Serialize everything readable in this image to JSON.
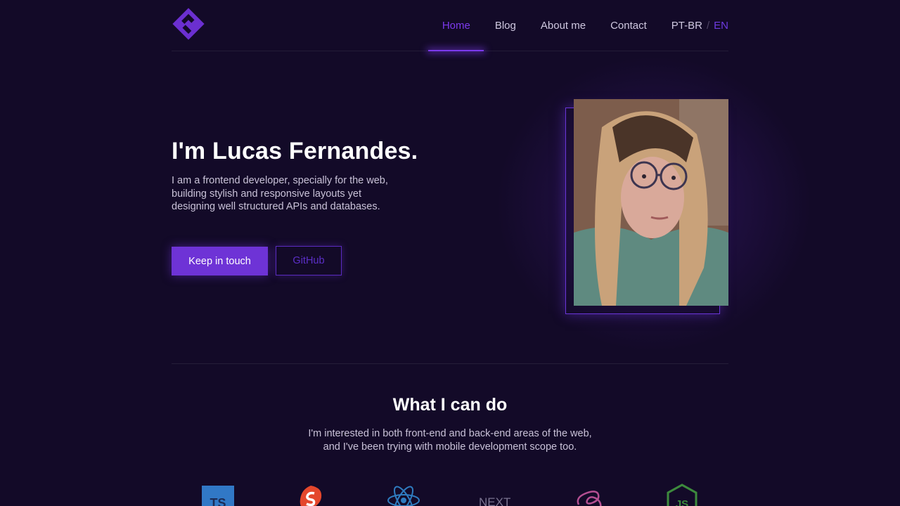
{
  "nav": {
    "items": [
      {
        "label": "Home",
        "active": true
      },
      {
        "label": "Blog",
        "active": false
      },
      {
        "label": "About me",
        "active": false
      },
      {
        "label": "Contact",
        "active": false
      }
    ],
    "lang_pt": "PT-BR",
    "lang_sep": "/",
    "lang_en": "EN"
  },
  "hero": {
    "title": "I'm Lucas Fernandes.",
    "description": "I am a frontend developer, specially for the web, building stylish and responsive layouts yet designing well structured APIs and databases.",
    "primary_button": "Keep in touch",
    "secondary_button": "GitHub"
  },
  "skills": {
    "title": "What I can do",
    "description_line1": "I'm interested in both front-end and back-end areas of the web,",
    "description_line2": "and I've been trying with mobile development scope too.",
    "icons": [
      "typescript-icon",
      "svelte-icon",
      "react-icon",
      "nextjs-icon",
      "sass-icon",
      "nodejs-icon"
    ],
    "ts_label": "TS",
    "next_label": "NEXT",
    "js_label": "JS"
  },
  "colors": {
    "background": "#130a28",
    "accent": "#6e33d6",
    "nav_active": "#7c3aed"
  }
}
